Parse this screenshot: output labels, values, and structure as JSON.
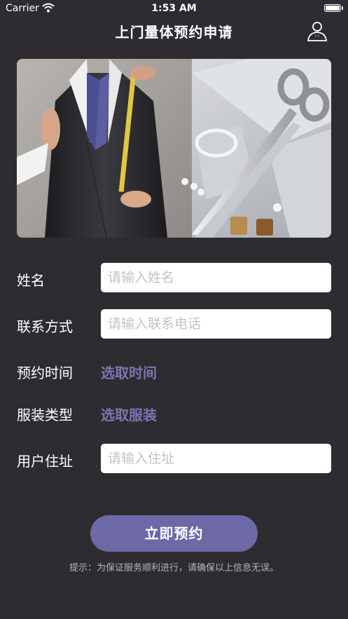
{
  "status_bar": {
    "carrier": "Carrier",
    "time": "1:53 AM"
  },
  "header": {
    "title": "上门量体预约申请",
    "user_icon": "user-icon"
  },
  "hero": {
    "image": "tailor-measuring-suit-photo"
  },
  "form": {
    "name": {
      "label": "姓名",
      "placeholder": "请输入姓名"
    },
    "contact": {
      "label": "联系方式",
      "placeholder": "请输入联系电话"
    },
    "appointment_time": {
      "label": "预约时间",
      "action": "选取时间"
    },
    "clothing_type": {
      "label": "服装类型",
      "action": "选取服装"
    },
    "address": {
      "label": "用户住址",
      "placeholder": "请输入住址"
    }
  },
  "submit_label": "立即预约",
  "tip": "提示：为保证服务顺利进行，请确保以上信息无误。",
  "colors": {
    "background": "#2e2c30",
    "accent": "#6d68a6",
    "link": "#7b75b0"
  }
}
